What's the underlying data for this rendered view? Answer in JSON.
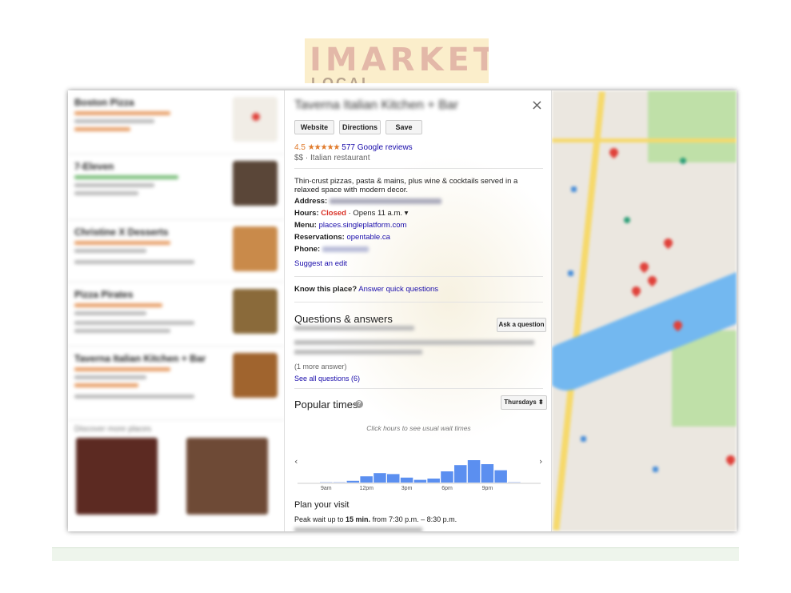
{
  "logo": {
    "main": "IMARKET",
    "sub": "LOCAL BUSINESSES"
  },
  "left_list": {
    "items": [
      {
        "title": "Boston Pizza"
      },
      {
        "title": "7-Eleven"
      },
      {
        "title": "Christine X Desserts"
      },
      {
        "title": "Pizza Pirates"
      },
      {
        "title": "Taverna Italian Kitchen + Bar"
      }
    ],
    "more_places": "Discover more places"
  },
  "panel": {
    "title": "Taverna Italian Kitchen + Bar",
    "close": "×",
    "buttons": {
      "website": "Website",
      "directions": "Directions",
      "save": "Save"
    },
    "rating": "4.5",
    "stars": "★★★★★",
    "reviews": "577 Google reviews",
    "category": "$$ · Italian restaurant",
    "description": "Thin-crust pizzas, pasta & mains, plus wine & cocktails served in a relaxed space with modern decor.",
    "address_label": "Address:",
    "hours_label": "Hours:",
    "hours_status": "Closed",
    "hours_detail": " · Opens 11 a.m. ▾",
    "menu_label": "Menu:",
    "menu_value": "places.singleplatform.com",
    "reservations_label": "Reservations:",
    "reservations_value": "opentable.ca",
    "phone_label": "Phone:",
    "suggest_edit": "Suggest an edit",
    "know_label": "Know this place?",
    "know_link": "Answer quick questions",
    "qa_title": "Questions & answers",
    "ask_button": "Ask a question",
    "more_answer": "(1 more answer)",
    "see_all": "See all questions (6)",
    "popular_title": "Popular times",
    "day_select": "Thursdays ⬍",
    "hint": "Click hours to see usual wait times",
    "plan_title": "Plan your visit",
    "peak_prefix": "Peak wait up to ",
    "peak_bold": "15 min.",
    "peak_suffix": " from 7:30 p.m. – 8:30 p.m."
  },
  "chart_data": {
    "type": "bar",
    "tick_labels": [
      "9am",
      "12pm",
      "3pm",
      "6pm",
      "9pm"
    ],
    "hours": [
      "9am",
      "10am",
      "11am",
      "12pm",
      "1pm",
      "2pm",
      "3pm",
      "4pm",
      "5pm",
      "6pm",
      "7pm",
      "8pm",
      "9pm",
      "10pm",
      "11pm"
    ],
    "values": [
      0,
      0,
      8,
      28,
      42,
      38,
      22,
      12,
      18,
      50,
      78,
      100,
      82,
      55,
      0
    ],
    "ylim": [
      0,
      100
    ],
    "bar_color": "#5b8ff0"
  }
}
